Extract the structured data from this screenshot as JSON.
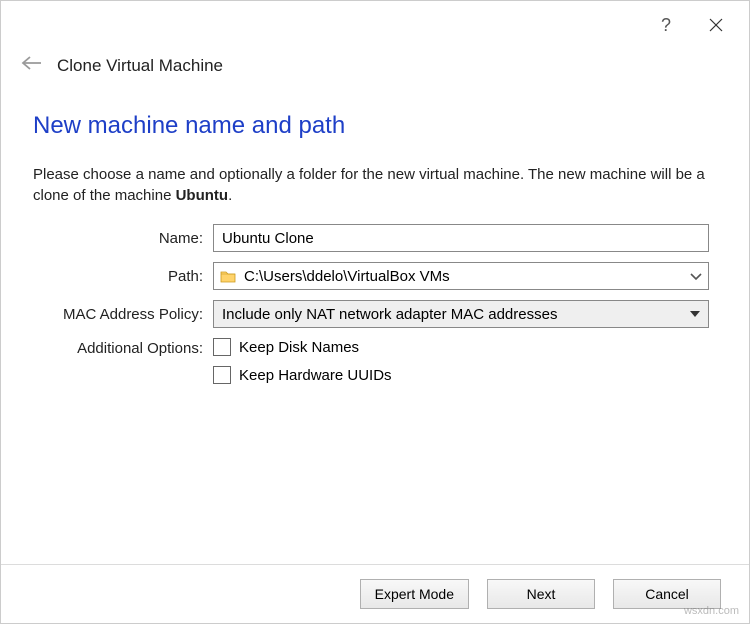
{
  "titlebar": {
    "help": "?",
    "close": "×"
  },
  "header": {
    "title": "Clone Virtual Machine"
  },
  "page": {
    "title": "New machine name and path",
    "desc_prefix": "Please choose a name and optionally a folder for the new virtual machine. The new machine will be a clone of the machine ",
    "desc_bold": "Ubuntu",
    "desc_suffix": "."
  },
  "form": {
    "name_label": "Name:",
    "name_value": "Ubuntu Clone",
    "path_label": "Path:",
    "path_value": "C:\\Users\\ddelo\\VirtualBox VMs",
    "mac_label": "MAC Address Policy:",
    "mac_value": "Include only NAT network adapter MAC addresses",
    "addl_label": "Additional Options:",
    "opt1": "Keep Disk Names",
    "opt2": "Keep Hardware UUIDs"
  },
  "footer": {
    "expert": "Expert Mode",
    "next": "Next",
    "cancel": "Cancel"
  },
  "watermark": "wsxdn.com"
}
